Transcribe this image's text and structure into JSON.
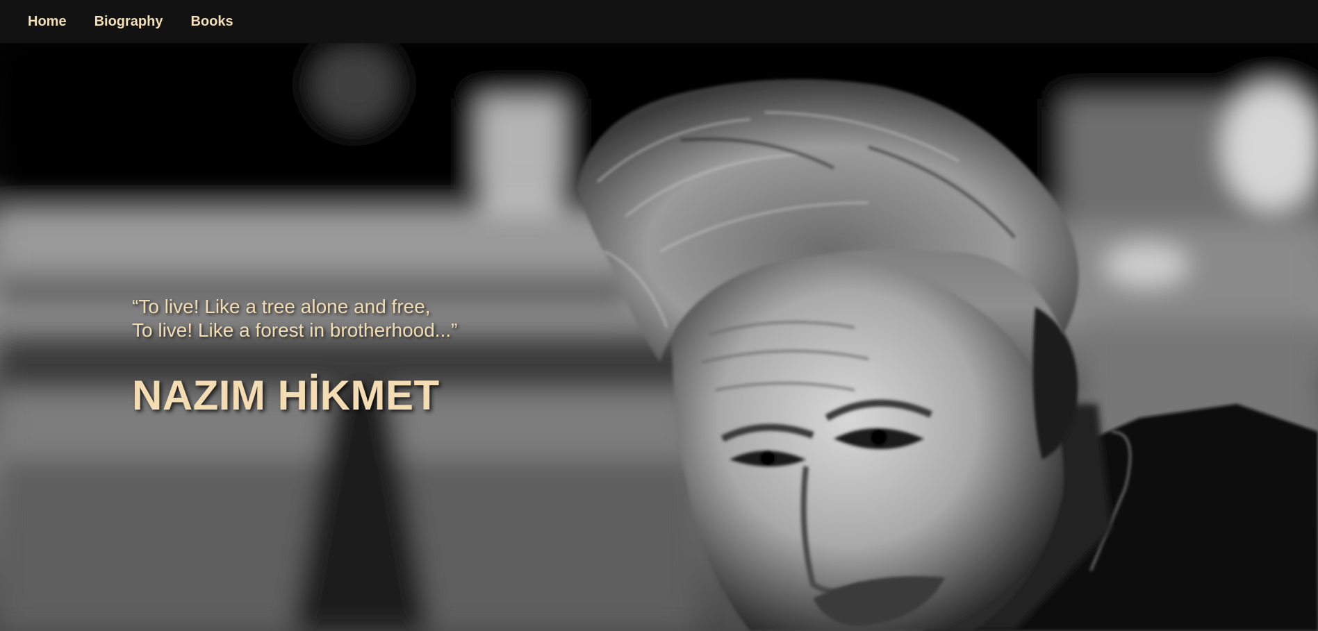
{
  "nav": {
    "items": [
      {
        "label": "Home"
      },
      {
        "label": "Biography"
      },
      {
        "label": "Books"
      }
    ]
  },
  "hero": {
    "quote_line1": "“To live! Like a tree alone and free,",
    "quote_line2": "To live! Like a forest in brotherhood...”",
    "title": "NAZIM HİKMET"
  },
  "colors": {
    "nav_background": "#121212",
    "accent_text": "#f4dcb3"
  }
}
